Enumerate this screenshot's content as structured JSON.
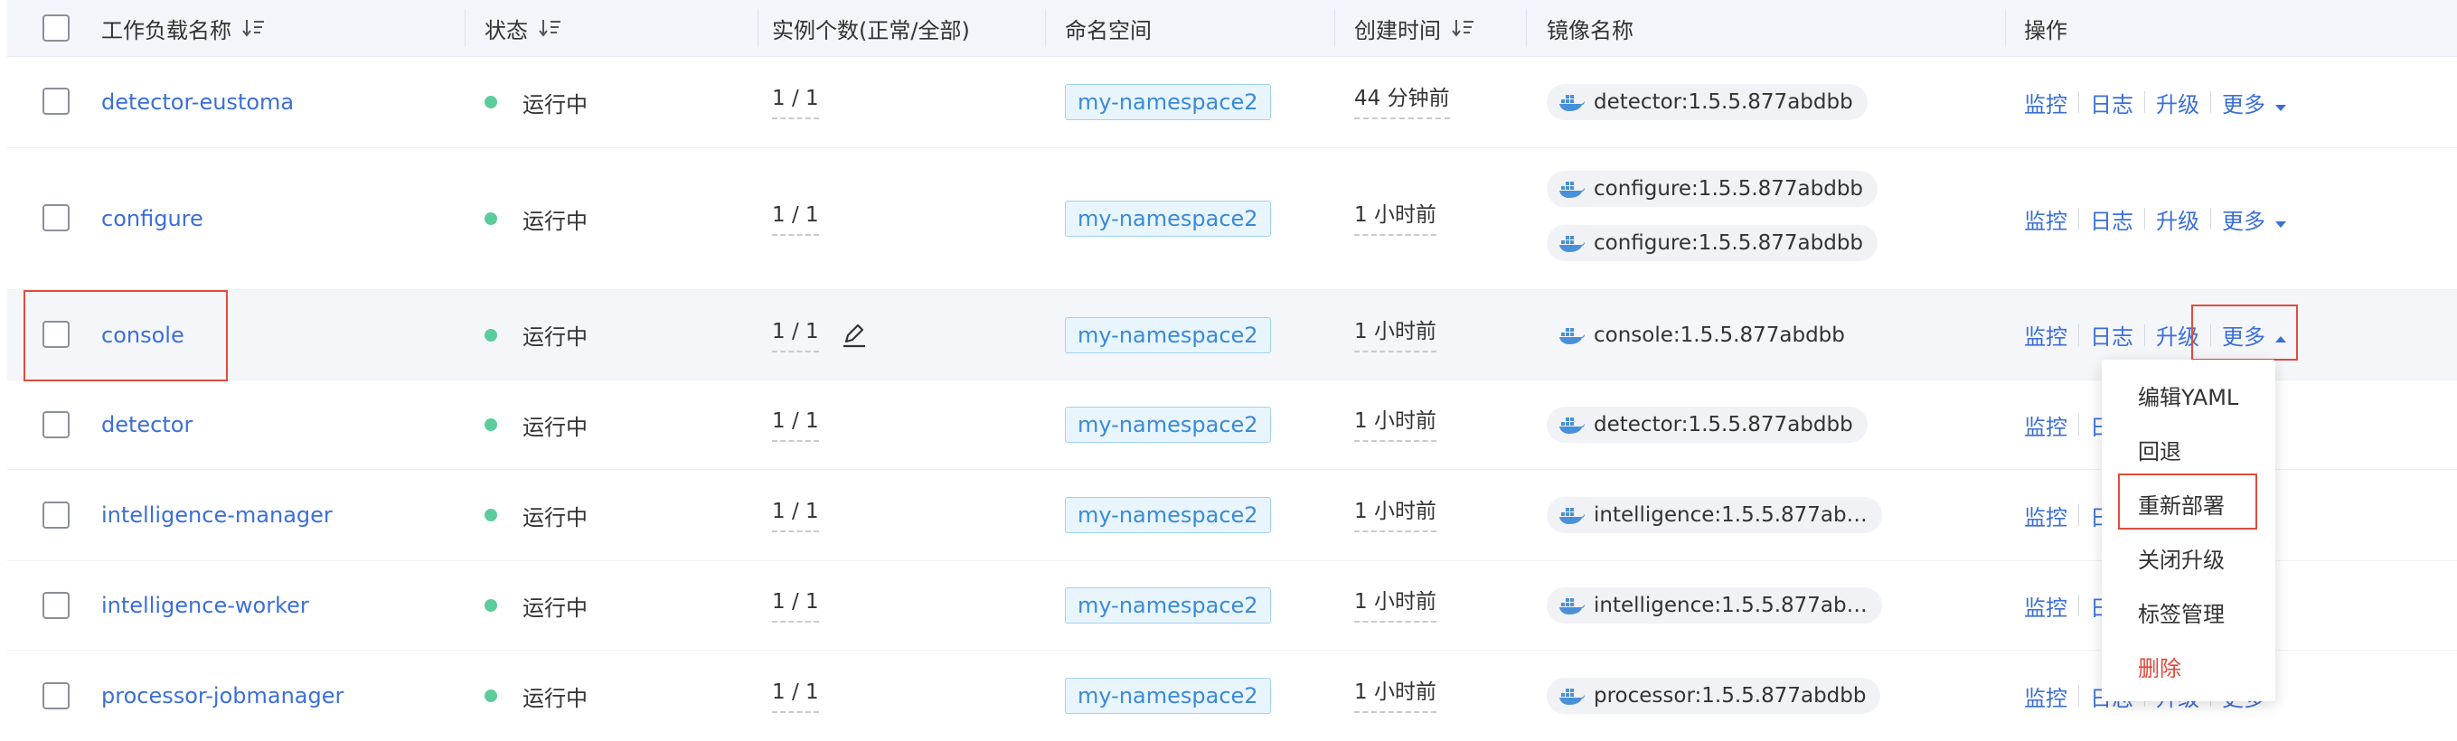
{
  "columns": {
    "name": "工作负载名称",
    "status": "状态",
    "instances": "实例个数(正常/全部)",
    "namespace": "命名空间",
    "created": "创建时间",
    "image": "镜像名称",
    "ops": "操作"
  },
  "rows": [
    {
      "name": "detector-eustoma",
      "status": "运行中",
      "instances": "1 / 1",
      "namespace": "my-namespace2",
      "created": "44 分钟前",
      "images": [
        "detector:1.5.5.877abdbb"
      ]
    },
    {
      "name": "configure",
      "status": "运行中",
      "instances": "1 / 1",
      "namespace": "my-namespace2",
      "created": "1 小时前",
      "images": [
        "configure:1.5.5.877abdbb",
        "configure:1.5.5.877abdbb"
      ]
    },
    {
      "name": "console",
      "status": "运行中",
      "instances": "1 / 1",
      "namespace": "my-namespace2",
      "created": "1 小时前",
      "images": [
        "console:1.5.5.877abdbb"
      ]
    },
    {
      "name": "detector",
      "status": "运行中",
      "instances": "1 / 1",
      "namespace": "my-namespace2",
      "created": "1 小时前",
      "images": [
        "detector:1.5.5.877abdbb"
      ]
    },
    {
      "name": "intelligence-manager",
      "status": "运行中",
      "instances": "1 / 1",
      "namespace": "my-namespace2",
      "created": "1 小时前",
      "images": [
        "intelligence:1.5.5.877ab…"
      ]
    },
    {
      "name": "intelligence-worker",
      "status": "运行中",
      "instances": "1 / 1",
      "namespace": "my-namespace2",
      "created": "1 小时前",
      "images": [
        "intelligence:1.5.5.877ab…"
      ]
    },
    {
      "name": "processor-jobmanager",
      "status": "运行中",
      "instances": "1 / 1",
      "namespace": "my-namespace2",
      "created": "1 小时前",
      "images": [
        "processor:1.5.5.877abdbb"
      ]
    }
  ],
  "actions": {
    "monitor": "监控",
    "logs": "日志",
    "upgrade": "升级",
    "more": "更多"
  },
  "more_menu": [
    "编辑YAML",
    "回退",
    "重新部署",
    "关闭升级",
    "标签管理",
    "删除"
  ],
  "colors": {
    "link": "#3b6fd8",
    "status_running": "#5ccc9c",
    "highlight_box": "#e24b3b",
    "danger": "#e2463a"
  }
}
